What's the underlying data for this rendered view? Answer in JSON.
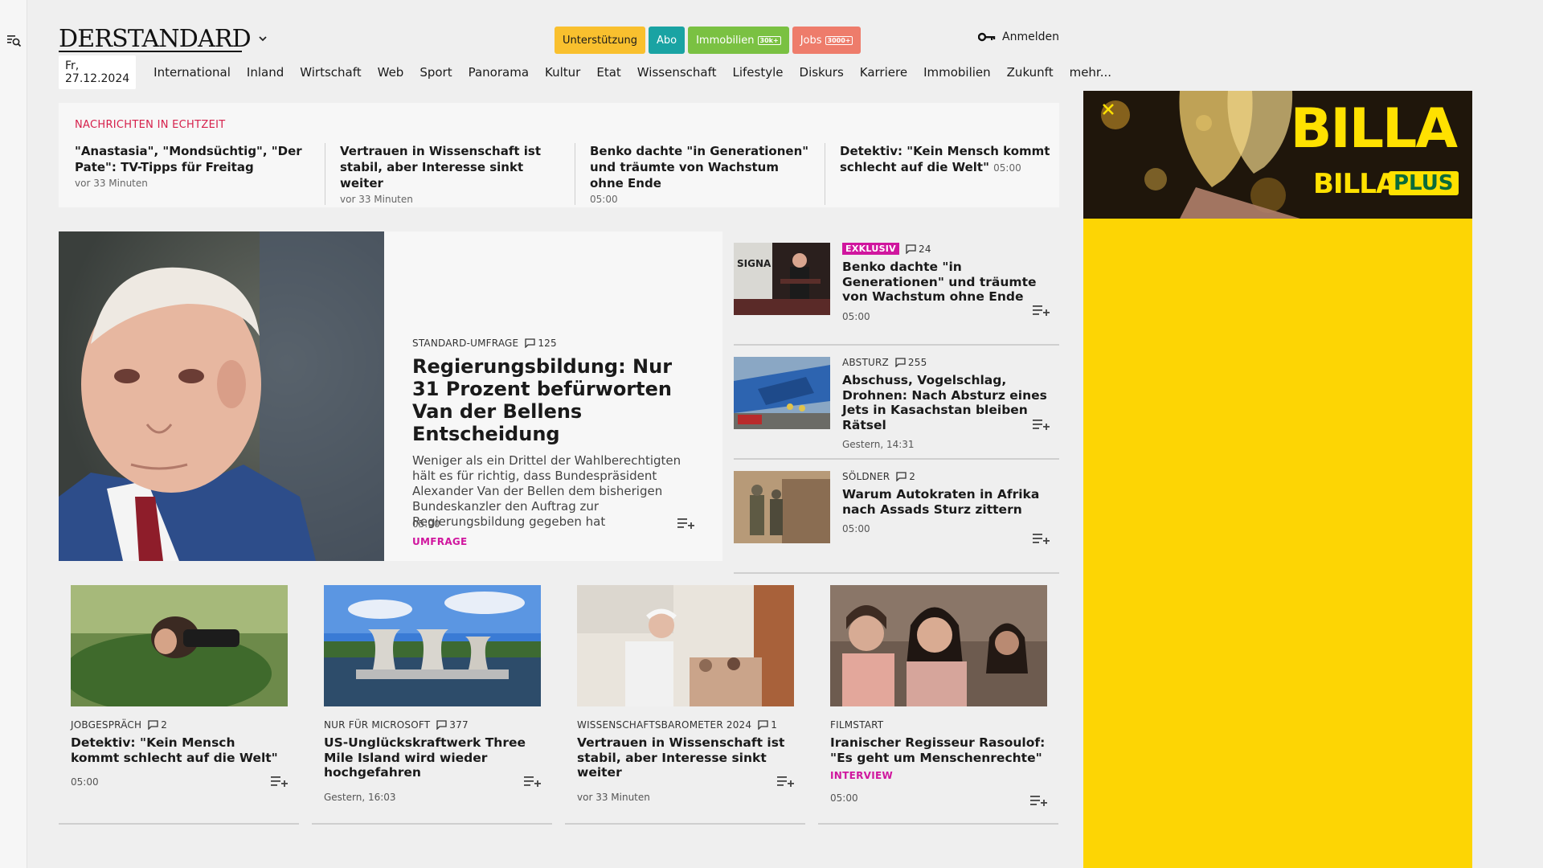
{
  "header": {
    "logo": "DERSTANDARD",
    "badges": {
      "support": "Unterstützung",
      "abo": "Abo",
      "immo": "Immobilien",
      "immo_count": "30k+",
      "jobs": "Jobs",
      "jobs_count": "3000+"
    },
    "login": "Anmelden"
  },
  "nav": {
    "date": "Fr, 27.12.2024",
    "items": [
      "International",
      "Inland",
      "Wirtschaft",
      "Web",
      "Sport",
      "Panorama",
      "Kultur",
      "Etat",
      "Wissenschaft",
      "Lifestyle",
      "Diskurs",
      "Karriere",
      "Immobilien",
      "Zukunft",
      "mehr..."
    ]
  },
  "ticker": {
    "heading": "NACHRICHTEN IN ECHTZEIT",
    "items": [
      {
        "title": "\"Anastasia\", \"Mondsüchtig\", \"Der Pate\": TV-Tipps für Freitag",
        "time": "vor 33 Minuten"
      },
      {
        "title": "Vertrauen in Wissenschaft ist stabil, aber Interesse sinkt weiter",
        "time": "vor 33 Minuten"
      },
      {
        "title": "Benko dachte \"in Generationen\" und träumte von Wachstum ohne Ende",
        "time": "05:00"
      },
      {
        "title": "Detektiv: \"Kein Mensch kommt schlecht auf die Welt\"",
        "time": "05:00"
      }
    ]
  },
  "main_story": {
    "kicker": "STANDARD-UMFRAGE",
    "comments": "125",
    "title": "Regierungsbildung: Nur 31 Prozent befürworten Van der Bellens Entscheidung",
    "lead": "Weniger als ein Drittel der Wahlberechtigten hält es für richtig, dass Bundespräsident Alexander Van der Bellen dem bisherigen Bundeskanzler den Auftrag zur Regierungsbildung gegeben hat",
    "tag": "UMFRAGE",
    "time": "05:00"
  },
  "side_items": [
    {
      "label": "EXKLUSIV",
      "comments": "24",
      "title": "Benko dachte \"in Generationen\" und träumte von Wachstum ohne Ende",
      "time": "05:00",
      "img_text": "SIGNA"
    },
    {
      "label": "ABSTURZ",
      "comments": "255",
      "title": "Abschuss, Vogelschlag, Drohnen: Nach Absturz eines Jets in Kasachstan bleiben Rätsel",
      "time": "Gestern, 14:31"
    },
    {
      "label": "SÖLDNER",
      "comments": "2",
      "title": "Warum Autokraten in Afrika nach Assads Sturz zittern",
      "time": "05:00"
    }
  ],
  "cards": [
    {
      "kicker": "JOBGESPRÄCH",
      "comments": "2",
      "title": "Detektiv: \"Kein Mensch kommt schlecht auf die Welt\"",
      "tag": "",
      "time": "05:00"
    },
    {
      "kicker": "NUR FÜR MICROSOFT",
      "comments": "377",
      "title": "US-Unglückskraftwerk Three Mile Island wird wieder hochgefahren",
      "tag": "",
      "time": "Gestern, 16:03"
    },
    {
      "kicker": "WISSENSCHAFTSBAROMETER 2024",
      "comments": "1",
      "title": "Vertrauen in Wissenschaft ist stabil, aber Interesse sinkt weiter",
      "tag": "",
      "time": "vor 33 Minuten"
    },
    {
      "kicker": "FILMSTART",
      "comments": "",
      "title": "Iranischer Regisseur Rasoulof: \"Es geht um Menschenrechte\"",
      "tag": "INTERVIEW",
      "time": "05:00"
    }
  ],
  "ad": {
    "brand": "BILLA",
    "brand2": "BILLA",
    "plus": "PLUS"
  },
  "colors": {
    "accent_red": "#d6204b",
    "accent_pink": "#d0169e",
    "ad_yellow": "#fdd504"
  }
}
